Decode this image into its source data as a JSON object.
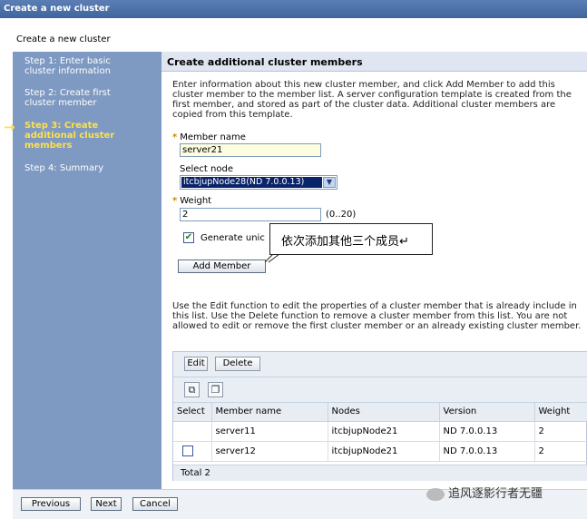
{
  "window": {
    "title": "Create a new cluster"
  },
  "page": {
    "subtitle": "Create a new cluster"
  },
  "sidebar": {
    "steps": [
      {
        "label": "Step 1: Enter basic cluster information",
        "active": false
      },
      {
        "label": "Step 2: Create first cluster member",
        "active": false
      },
      {
        "label": "Step 3: Create additional cluster members",
        "active": true
      },
      {
        "label": "Step 4: Summary",
        "active": false
      }
    ],
    "current_arrow": "→"
  },
  "main": {
    "heading": "Create additional cluster members",
    "intro": "Enter information about this new cluster member, and click Add Member to add this cluster member to the member list. A server configuration template is created from the first member, and stored as part of the cluster data. Additional cluster members are copied from this template.",
    "member_name": {
      "label": "Member name",
      "value": "server21"
    },
    "select_node": {
      "label": "Select node",
      "value": "itcbjupNode28(ND 7.0.0.13)"
    },
    "weight": {
      "label": "Weight",
      "value": "2",
      "range": "(0..20)"
    },
    "generate": {
      "label": "Generate unic",
      "checked": true
    },
    "add_member_label": "Add Member",
    "callout": "依次添加其他三个成员↵",
    "edit_info": "Use the Edit function to edit the properties of a cluster member that is already include in this list. Use the Delete function to remove a cluster member from this list. You are not allowed to edit or remove the first cluster member or an already existing cluster member."
  },
  "table": {
    "edit_label": "Edit",
    "delete_label": "Delete",
    "columns": [
      "Select",
      "Member name",
      "Nodes",
      "Version",
      "Weight"
    ],
    "rows": [
      {
        "select": false,
        "member": "server11",
        "node": "itcbjupNode21",
        "version": "ND 7.0.0.13",
        "weight": "2"
      },
      {
        "select": true,
        "member": "server12",
        "node": "itcbjupNode21",
        "version": "ND 7.0.0.13",
        "weight": "2"
      }
    ],
    "total": "Total 2"
  },
  "footer": {
    "previous_label": "Previous",
    "next_label": "Next",
    "cancel_label": "Cancel"
  },
  "watermark": {
    "text": "追风逐影行者无疆"
  },
  "icons": {
    "required": "*",
    "check": "✔",
    "select_arrow": "▼",
    "select_all": "⧉",
    "deselect_all": "❐"
  }
}
